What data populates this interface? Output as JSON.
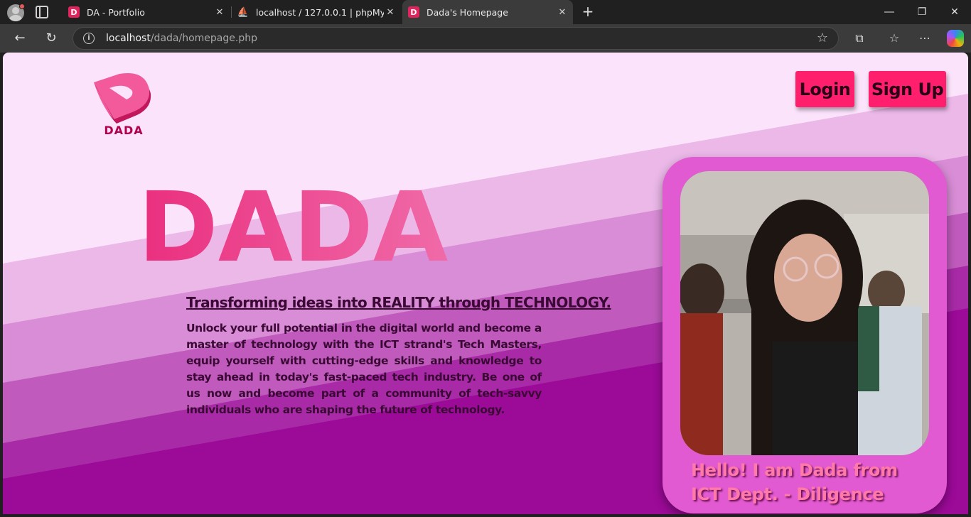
{
  "browser": {
    "tabs": [
      {
        "title": "DA - Portfolio",
        "icon": "dada-favicon-icon",
        "active": false
      },
      {
        "title": "localhost / 127.0.0.1 | phpMyAdm",
        "icon": "phpmyadmin-favicon-icon",
        "active": false
      },
      {
        "title": "Dada's Homepage",
        "icon": "dada-favicon-icon",
        "active": true
      }
    ],
    "favicon_letter": "D",
    "address": {
      "host": "localhost",
      "path": "/dada/homepage.php"
    }
  },
  "page": {
    "logo_text": "DADA",
    "nav": {
      "login_label": "Login",
      "signup_label": "Sign Up"
    },
    "hero_title": "DADA",
    "tagline": "Transforming ideas into REALITY through TECHNOLOGY.",
    "description": "Unlock your full potential in the digital world and become a master of technology with the ICT strand's Tech Masters, equip yourself with cutting-edge skills and knowledge to stay ahead in today's fast-paced tech industry. Be one of us now and become part of a community of tech-savvy individuals who are shaping the future of technology.",
    "profile_caption_line1": "Hello! I am Dada from",
    "profile_caption_line2": "ICT Dept. - Diligence"
  },
  "colors": {
    "page_bg": "#fbe3fb",
    "band1": "#ebb8e8",
    "band2": "#d98dd6",
    "band3": "#c05bbd",
    "band4": "#a82aa6",
    "band5": "#9c0a98",
    "button": "#ff1f6d",
    "hero": "#f24a93",
    "card": "#e25ad2"
  }
}
